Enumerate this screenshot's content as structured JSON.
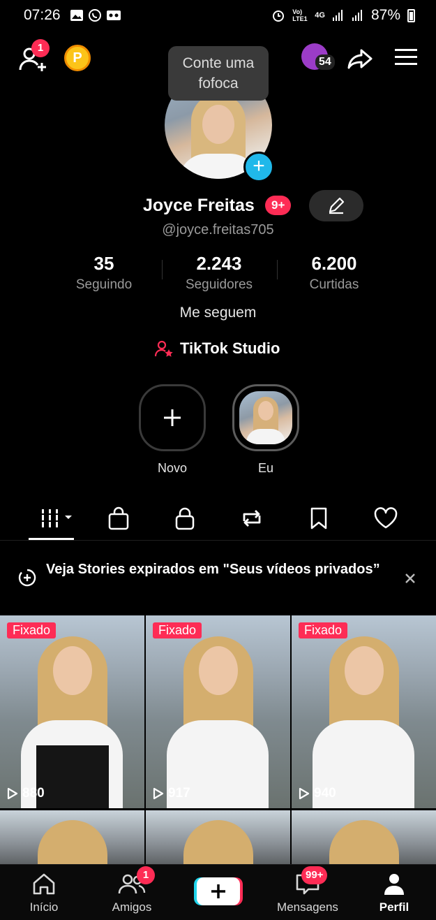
{
  "status_bar": {
    "time": "07:26",
    "battery": "87%",
    "network_label": "4G",
    "lte_label": "Vo) LTE1"
  },
  "top_bar": {
    "friend_requests_badge": "1",
    "coin_label": "P",
    "tooltip_text": "Conte uma fofoca",
    "mini_avatar_count": "54"
  },
  "profile": {
    "name": "Joyce Freitas",
    "name_badge": "9+",
    "handle": "@joyce.freitas705",
    "stats": [
      {
        "value": "35",
        "label": "Seguindo"
      },
      {
        "value": "2.243",
        "label": "Seguidores"
      },
      {
        "value": "6.200",
        "label": "Curtidas"
      }
    ],
    "follow_me_label": "Me seguem",
    "studio_label": "TikTok Studio"
  },
  "stories": {
    "new_label": "Novo",
    "me_label": "Eu"
  },
  "tabs": [
    "videos-tab",
    "shop-tab",
    "private-tab",
    "reposts-tab",
    "favorites-tab",
    "liked-tab"
  ],
  "banner": {
    "text": "Veja Stories expirados em \"Seus vídeos privados”"
  },
  "videos": [
    {
      "pinned_label": "Fixado",
      "views": "880"
    },
    {
      "pinned_label": "Fixado",
      "views": "917"
    },
    {
      "pinned_label": "Fixado",
      "views": "940"
    }
  ],
  "bottom_nav": {
    "home": "Início",
    "friends": "Amigos",
    "friends_badge": "1",
    "messages": "Mensagens",
    "messages_badge": "99+",
    "profile": "Perfil"
  },
  "colors": {
    "accent": "#fe2c55",
    "cyan": "#20b8ea",
    "background": "#000000"
  }
}
